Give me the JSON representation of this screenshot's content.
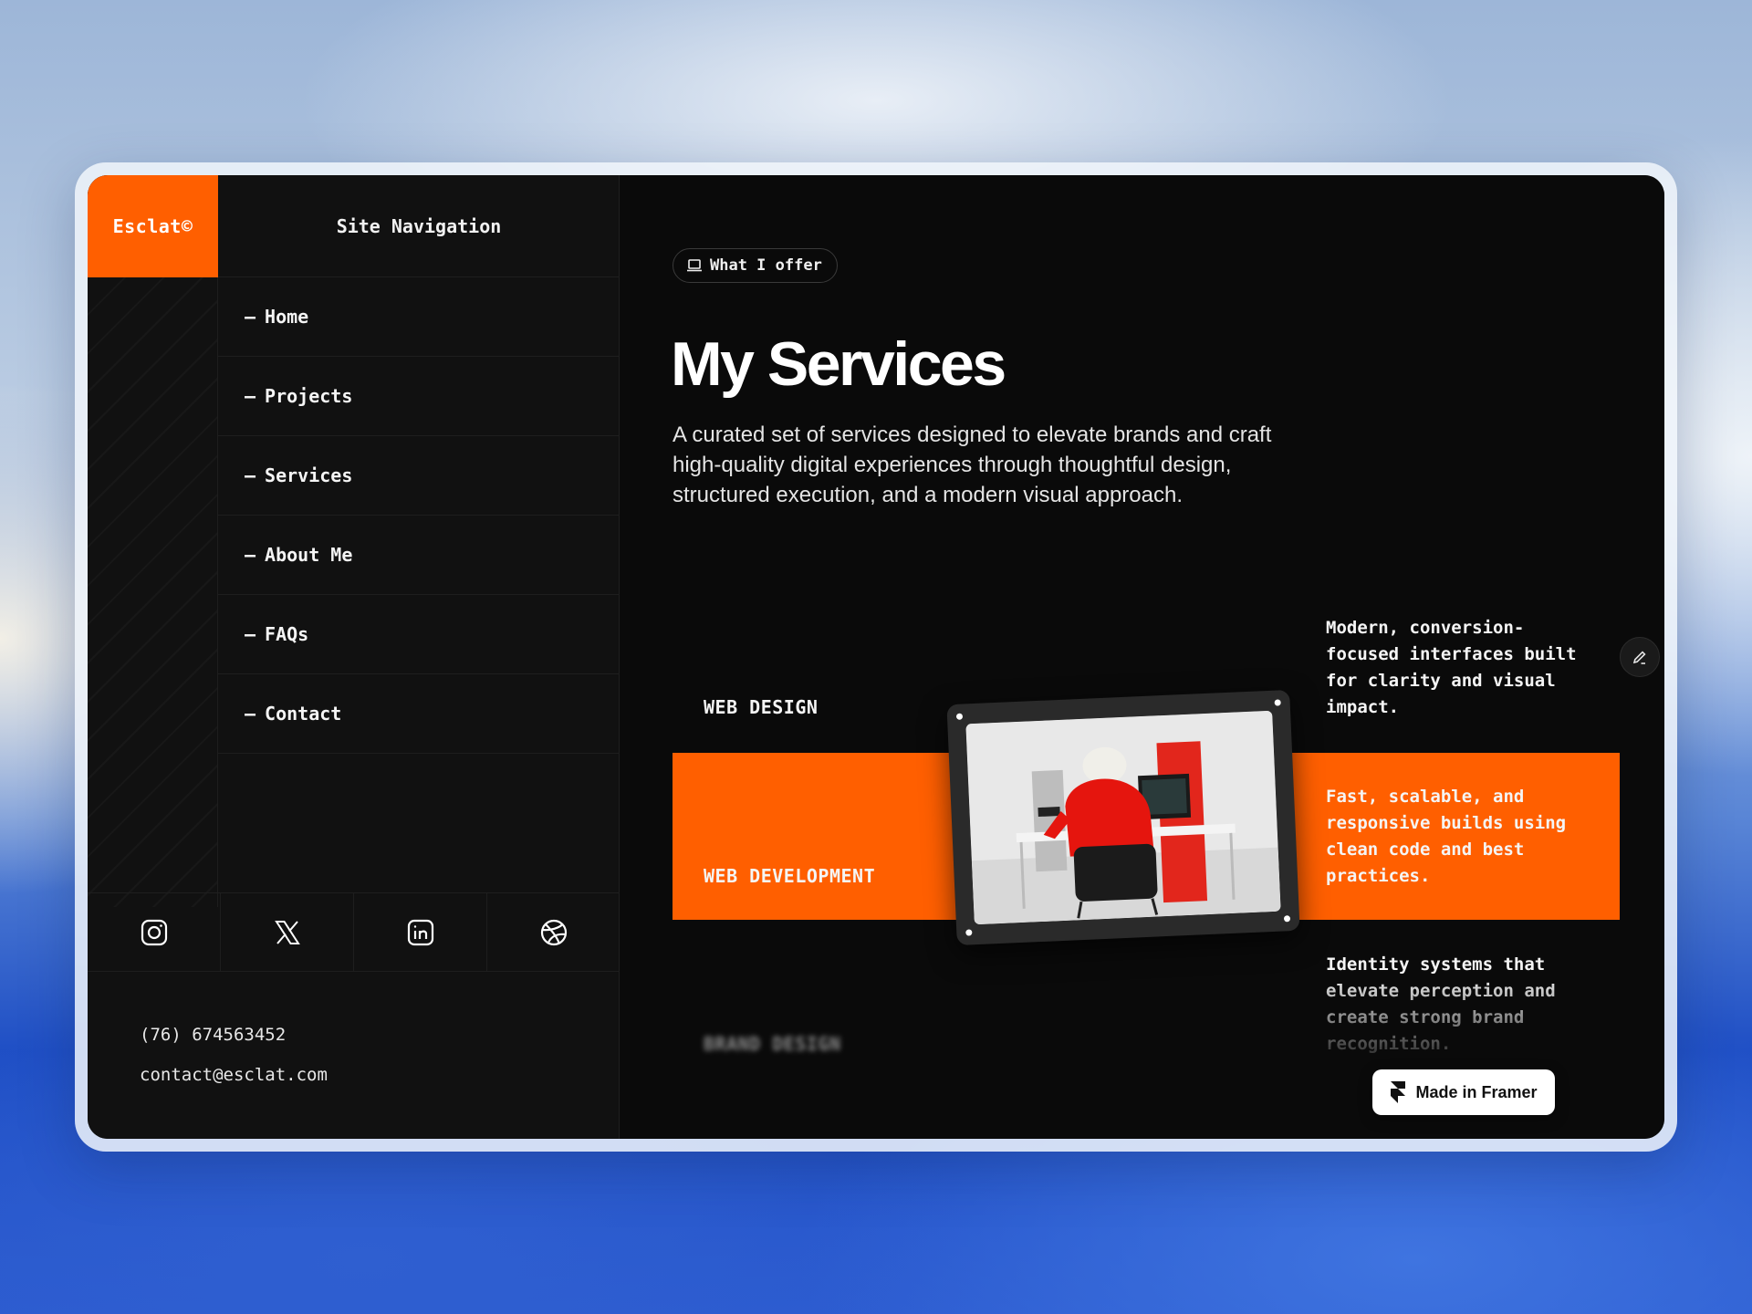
{
  "brand": {
    "logo_text": "Esclat©",
    "accent_color": "#ff5f00"
  },
  "sidebar": {
    "nav_title": "Site Navigation",
    "items": [
      {
        "dash": "–",
        "label": "Home"
      },
      {
        "dash": "–",
        "label": "Projects"
      },
      {
        "dash": "–",
        "label": "Services"
      },
      {
        "dash": "–",
        "label": "About Me"
      },
      {
        "dash": "–",
        "label": "FAQs"
      },
      {
        "dash": "–",
        "label": "Contact"
      }
    ],
    "socials": [
      "instagram-icon",
      "x-icon",
      "linkedin-icon",
      "dribbble-icon"
    ],
    "phone": "(76) 674563452",
    "email": "contact@esclat.com"
  },
  "main": {
    "pill_label": "What I offer",
    "pill_icon": "laptop-icon",
    "title": "My Services",
    "description": "A curated set of services designed to elevate brands and craft high-quality digital experiences through thoughtful design, structured execution, and a modern visual approach.",
    "services": [
      {
        "name": "WEB DESIGN",
        "text": "Modern, conversion-focused interfaces built for clarity and visual impact."
      },
      {
        "name": "WEB DEVELOPMENT",
        "text": "Fast, scalable, and responsive builds using clean code and best practices."
      },
      {
        "name": "BRAND DESIGN",
        "text": "Identity systems that elevate perception and create strong brand recognition."
      }
    ]
  },
  "framer_badge": {
    "label": "Made in Framer"
  }
}
